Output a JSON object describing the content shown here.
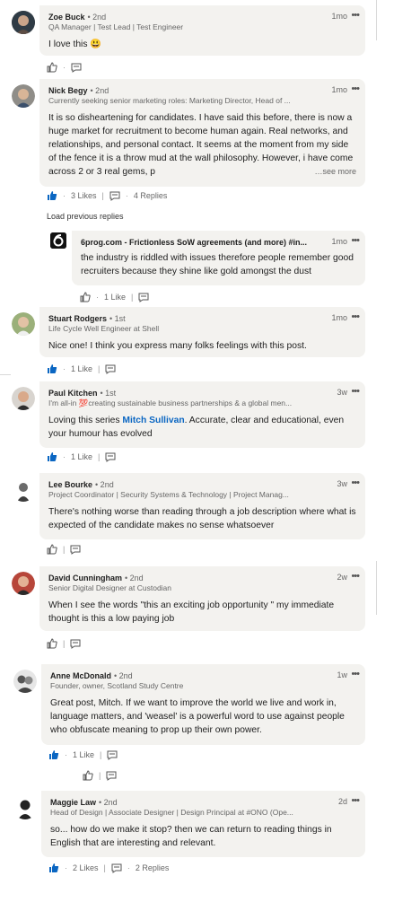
{
  "load_previous": "Load previous replies",
  "see_more": "…see more",
  "comments": [
    {
      "name": "Zoe Buck",
      "degree": "• 2nd",
      "subtitle": "QA Manager | Test Lead | Test Engineer",
      "time": "1mo",
      "text": "I love this 😃"
    },
    {
      "name": "Nick Begy",
      "degree": "• 2nd",
      "subtitle": "Currently seeking senior marketing roles: Marketing Director, Head of ...",
      "time": "1mo",
      "text": "It is so disheartening for candidates. I have said this before, there is now a huge market for recruitment to become human again. Real networks, and relationships, and personal contact. It seems at the moment from my side of the fence it is a throw mud at the wall philosophy. However, i have come across 2 or 3 real gems, p",
      "likes": "3 Likes",
      "replies": "4 Replies"
    },
    {
      "name": "6prog.com - Frictionless SoW agreements (and more) #in...",
      "degree": "",
      "subtitle": "",
      "time": "1mo",
      "text": "the industry is riddled with issues therefore people remember good recruiters because they shine like gold amongst the dust",
      "likes": "1 Like"
    },
    {
      "name": "Stuart Rodgers",
      "degree": "• 1st",
      "subtitle": "Life Cycle Well Engineer at Shell",
      "time": "1mo",
      "text": "Nice one! I think you express many folks feelings with this post.",
      "likes": "1 Like"
    },
    {
      "name": "Paul Kitchen",
      "degree": "• 1st",
      "subtitle": "I'm all-in 💯creating sustainable business partnerships & a global men...",
      "time": "3w",
      "text_pre": "Loving this series ",
      "mention": "Mitch Sullivan",
      "text_post": ". Accurate, clear and educational, even your humour has evolved",
      "likes": "1 Like"
    },
    {
      "name": "Lee Bourke",
      "degree": "• 2nd",
      "subtitle": "Project Coordinator | Security Systems & Technology | Project Manag...",
      "time": "3w",
      "text": "There's nothing worse than reading through a job description where what is expected of the candidate makes no sense whatsoever"
    },
    {
      "name": "David Cunningham",
      "degree": "• 2nd",
      "subtitle": "Senior Digital Designer at Custodian",
      "time": "2w",
      "text": "When I see the words \"this an exciting job opportunity \" my immediate thought is this a low paying job"
    },
    {
      "name": "Anne McDonald",
      "degree": "• 2nd",
      "subtitle": "Founder, owner, Scotland Study Centre",
      "time": "1w",
      "text": "Great post,  Mitch.  If we want to improve the world we live and work in,  language matters,  and 'weasel' is a powerful word to use against people who obfuscate meaning to prop up their own power.",
      "likes": "1 Like"
    },
    {
      "name": "Maggie Law",
      "degree": "• 2nd",
      "subtitle": "Head of Design | Associate Designer | Design Principal at #ONO (Ope...",
      "time": "2d",
      "text": "so... how do we make it stop? then we can return to reading things in English that are interesting and relevant.",
      "likes": "2 Likes",
      "replies": "2 Replies"
    }
  ]
}
